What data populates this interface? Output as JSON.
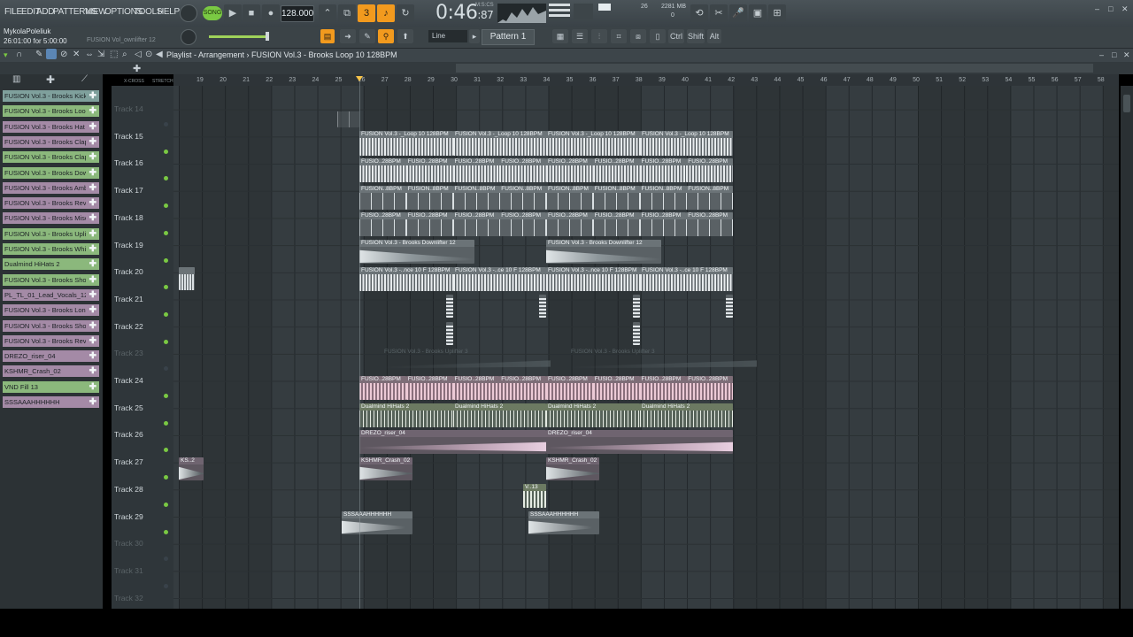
{
  "menu": [
    "FILE",
    "EDIT",
    "ADD",
    "PATTERNS",
    "VIEW",
    "OPTIONS",
    "TOOLS",
    "HELP"
  ],
  "transport": {
    "song_label": "SONG",
    "tempo": "128.000",
    "time": "0:46",
    "time_small": ":87",
    "time_unit": "M:S:CS",
    "cpu": "26",
    "memory": "2281 MB",
    "polyphony": "0"
  },
  "user": {
    "name": "MykolaPoleliuk",
    "time": "26:01:00 for 5:00:00",
    "hint": "FUSION Vol_ownlifter 12"
  },
  "toolbar2": {
    "snap_value": "Line",
    "pattern": "Pattern 1",
    "keys": [
      "Ctrl",
      "Shift",
      "Alt"
    ]
  },
  "breadcrumb": "Playlist - Arrangement › FUSION Vol.3 - Brooks Loop 10 128BPM",
  "channels": [
    {
      "label": "FUSION Vol.3 - Brooks Kick 2",
      "color": "#7fa09c"
    },
    {
      "label": "FUSION Vol.3 - Brooks Loop...",
      "color": "#8bb87c"
    },
    {
      "label": "FUSION Vol.3 - Brooks Hat L...",
      "color": "#a48aa6"
    },
    {
      "label": "FUSION Vol.3 - Brooks Clap...",
      "color": "#a48aa6"
    },
    {
      "label": "FUSION Vol.3 - Brooks Clap...",
      "color": "#8bb87c"
    },
    {
      "label": "FUSION Vol.3 - Brooks Dow...",
      "color": "#8bb87c"
    },
    {
      "label": "FUSION Vol.3 - Brooks Ambi...",
      "color": "#a48aa6"
    },
    {
      "label": "FUSION Vol.3 - Brooks Reve...",
      "color": "#a48aa6"
    },
    {
      "label": "FUSION Vol.3 - Brooks Misc...",
      "color": "#a48aa6"
    },
    {
      "label": "FUSION Vol.3 - Brooks Uplif...",
      "color": "#8bb87c"
    },
    {
      "label": "FUSION Vol.3 - Brooks Whit...",
      "color": "#8bb87c"
    },
    {
      "label": "Dualmind HiHats 2",
      "color": "#8bb87c"
    },
    {
      "label": "FUSION Vol.3 - Brooks Shor...",
      "color": "#8bb87c"
    },
    {
      "label": "PL_TL_01_Lead_Vocals_12...",
      "color": "#a48aa6"
    },
    {
      "label": "FUSION Vol.3 - Brooks Long...",
      "color": "#a48aa6"
    },
    {
      "label": "FUSION Vol.3 - Brooks Shor...",
      "color": "#a48aa6"
    },
    {
      "label": "FUSION Vol.3 - Brooks Reve...",
      "color": "#a48aa6"
    },
    {
      "label": "DREZO_riser_04",
      "color": "#a48aa6"
    },
    {
      "label": "KSHMR_Crash_02",
      "color": "#a48aa6"
    },
    {
      "label": "VND Fill 13",
      "color": "#8bb87c"
    },
    {
      "label": "SSSAAAHHHHHH",
      "color": "#a48aa6"
    }
  ],
  "tracks": [
    {
      "label": "Track 14",
      "dim": true
    },
    {
      "label": "Track 15",
      "dim": false
    },
    {
      "label": "Track 16",
      "dim": false
    },
    {
      "label": "Track 17",
      "dim": false
    },
    {
      "label": "Track 18",
      "dim": false
    },
    {
      "label": "Track 19",
      "dim": false
    },
    {
      "label": "Track 20",
      "dim": false
    },
    {
      "label": "Track 21",
      "dim": false
    },
    {
      "label": "Track 22",
      "dim": false
    },
    {
      "label": "Track 23",
      "dim": true
    },
    {
      "label": "Track 24",
      "dim": false
    },
    {
      "label": "Track 25",
      "dim": false
    },
    {
      "label": "Track 26",
      "dim": false
    },
    {
      "label": "Track 27",
      "dim": false
    },
    {
      "label": "Track 28",
      "dim": false
    },
    {
      "label": "Track 29",
      "dim": false
    },
    {
      "label": "Track 30",
      "dim": true
    },
    {
      "label": "Track 31",
      "dim": true
    },
    {
      "label": "Track 32",
      "dim": true
    }
  ],
  "ruler": [
    "19",
    "20",
    "21",
    "22",
    "23",
    "24",
    "25",
    "26",
    "27",
    "28",
    "29",
    "30",
    "31",
    "32",
    "33",
    "34",
    "35",
    "36",
    "37",
    "38",
    "39",
    "40",
    "41",
    "42",
    "43",
    "44",
    "45",
    "46",
    "47",
    "48",
    "49",
    "50",
    "51",
    "52",
    "53",
    "54",
    "55",
    "56",
    "57",
    "58"
  ],
  "clips": {
    "t15": [
      "FUSION Vol.3 -_Loop 10 128BPM",
      "FUSION Vol.3 -_Loop 10 128BPM",
      "FUSION Vol.3 -_Loop 10 128BPM",
      "FUSION Vol.3 -_Loop 10 128BPM"
    ],
    "t16": [
      "FUSIO..28BPM",
      "FUSIO..28BPM",
      "FUSIO..28BPM",
      "FUSIO..28BPM",
      "FUSIO..28BPM",
      "FUSIO..28BPM",
      "FUSIO..28BPM",
      "FUSIO..28BPM"
    ],
    "t17": [
      "FUSION..8BPM",
      "FUSION..8BPM",
      "FUSION..8BPM",
      "FUSION..8BPM",
      "FUSION..8BPM",
      "FUSION..8BPM",
      "FUSION..8BPM",
      "FUSION..8BPM"
    ],
    "t18": [
      "FUSIO..28BPM",
      "FUSIO..28BPM",
      "FUSIO..28BPM",
      "FUSIO..28BPM",
      "FUSIO..28BPM",
      "FUSIO..28BPM",
      "FUSIO..28BPM",
      "FUSIO..28BPM"
    ],
    "t19": [
      "FUSION Vol.3 - Brooks Downlifter 12",
      "FUSION Vol.3 - Brooks Downlifter 12"
    ],
    "t20": [
      "FUSION Vol.3 -..nce 10 F 128BPM",
      "FUSION Vol.3 -..ce 10 F 128BPM",
      "FUSION Vol.3 -..nce 10 F 128BPM",
      "FUSION Vol.3 -..ce 10 F 128BPM"
    ],
    "t23": [
      "FUSION Vol.3 - Brooks Uplifter 3",
      "FUSION Vol.3 - Brooks Uplifter 3"
    ],
    "t24": [
      "FUSIO..28BPM",
      "FUSIO..28BPM",
      "FUSIO..28BPM",
      "FUSIO..28BPM",
      "FUSIO..28BPM",
      "FUSIO..28BPM",
      "FUSIO..28BPM",
      "FUSIO..28BPM"
    ],
    "t25": [
      "Dualmind HiHats 2",
      "Dualmind HiHats 2",
      "Dualmind HiHats 2",
      "Dualmind HiHats 2"
    ],
    "t26": [
      "DREZO_riser_04",
      "DREZO_riser_04"
    ],
    "t27": [
      "KS..2",
      "KSHMR_Crash_02",
      "KSHMR_Crash_02"
    ],
    "t28": [
      "V..13"
    ],
    "t29": [
      "SSSAAAHHHHHH",
      "SSSAAAHHHHHH"
    ]
  }
}
